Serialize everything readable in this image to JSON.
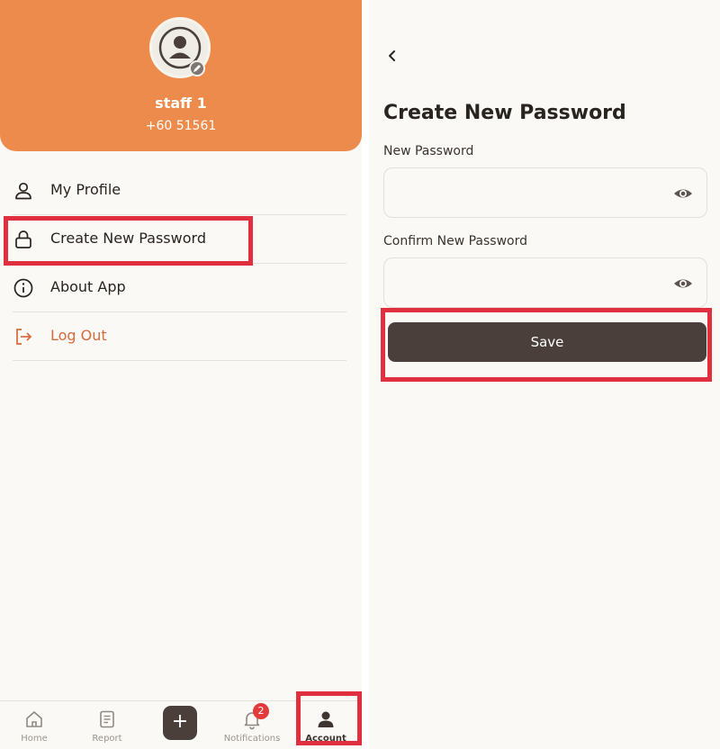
{
  "colors": {
    "accent_orange": "#ec8b4b",
    "dark_brown": "#4a3f3a",
    "background": "#fbf9f5",
    "logout_text": "#d76a3c",
    "highlight_red": "#e0303f",
    "badge_red": "#e33b3b"
  },
  "profile": {
    "name": "staff 1",
    "phone": "+60 51561",
    "avatar_icon": "user-icon",
    "edit_icon": "pencil-icon"
  },
  "menu": {
    "items": [
      {
        "label": "My Profile",
        "icon": "user-icon"
      },
      {
        "label": "Create New Password",
        "icon": "lock-icon"
      },
      {
        "label": "About App",
        "icon": "info-icon"
      },
      {
        "label": "Log Out",
        "icon": "logout-icon"
      }
    ]
  },
  "bottom_nav": {
    "items": [
      {
        "label": "Home",
        "icon": "home-icon"
      },
      {
        "label": "Report",
        "icon": "report-icon"
      },
      {
        "label": "+",
        "icon": "plus-icon"
      },
      {
        "label": "Notifications",
        "icon": "bell-icon",
        "badge": "2"
      },
      {
        "label": "Account",
        "icon": "account-icon",
        "active": true
      }
    ]
  },
  "password_screen": {
    "title": "Create New Password",
    "new_password_label": "New Password",
    "new_password_value": "",
    "confirm_password_label": "Confirm New Password",
    "confirm_password_value": "",
    "save_label": "Save"
  }
}
